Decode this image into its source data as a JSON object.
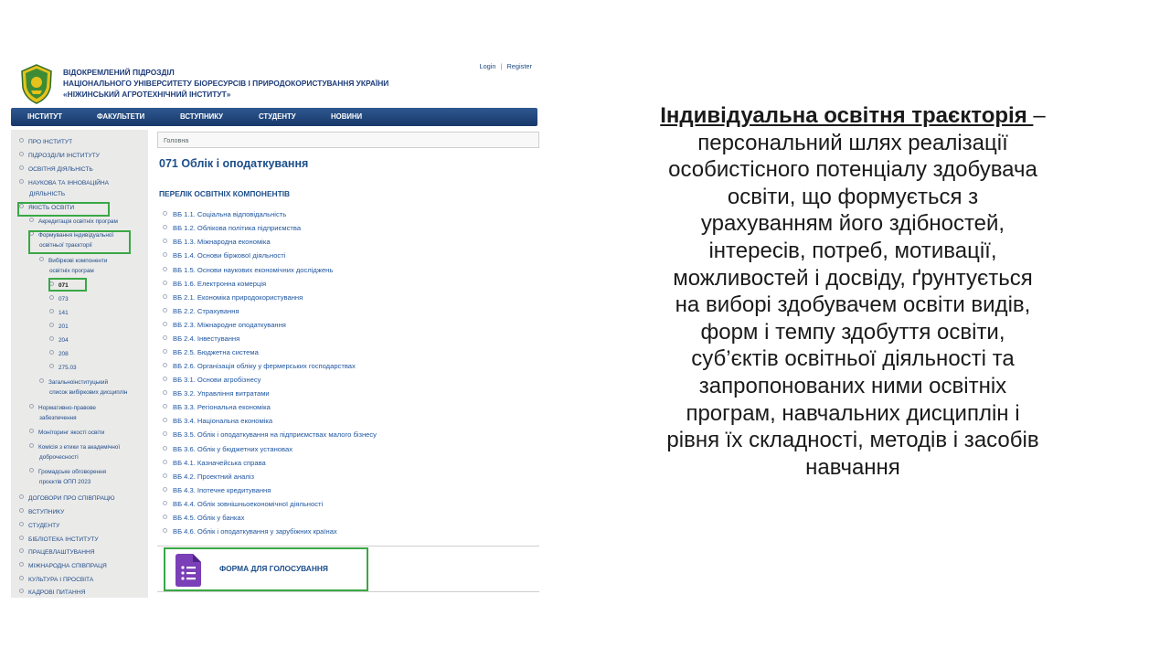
{
  "header": {
    "title_lines": [
      "ВІДОКРЕМЛЕНИЙ ПІДРОЗДІЛ",
      "НАЦІОНАЛЬНОГО УНІВЕРСИТЕТУ БІОРЕСУРСІВ І ПРИРОДОКОРИСТУВАННЯ УКРАЇНИ",
      "«НІЖИНСЬКИЙ АГРОТЕХНІЧНИЙ ІНСТИТУТ»"
    ],
    "login": "Login",
    "separator": "|",
    "register": "Register"
  },
  "topnav": [
    "ІНСТИТУТ",
    "ФАКУЛЬТЕТИ",
    "ВСТУПНИКУ",
    "СТУДЕНТУ",
    "НОВИНИ"
  ],
  "sidebar": {
    "items": [
      "ПРО ІНСТИТУТ",
      "ПІДРОЗДІЛИ ІНСТИТУТУ",
      "ОСВІТНЯ ДІЯЛЬНІСТЬ",
      "НАУКОВА ТА ІННОВАЦІЙНА",
      "ДІЯЛЬНІСТЬ",
      "ЯКІСТЬ ОСВІТИ",
      "Акредитація освітніх програм",
      "Формування індивідуальної",
      "освітньої траєкторії",
      "Вибіркові компоненти",
      "освітніх програм",
      "071",
      "073",
      "141",
      "201",
      "204",
      "208",
      "275.03",
      "Загальноінституцький",
      "список вибіркових дисциплін",
      "Нормативно-правове",
      "забезпечення",
      "Моніторинг якості освіти",
      "Комісія з етики та академічної",
      "доброчесності",
      "Громадське обговорення",
      "проєктів ОПП 2023",
      "ДОГОВОРИ ПРО СПІВПРАЦЮ",
      "ВСТУПНИКУ",
      "СТУДЕНТУ",
      "БІБЛІОТЕКА ІНСТИТУТУ",
      "ПРАЦЕВЛАШТУВАННЯ",
      "МІЖНАРОДНА СПІВПРАЦЯ",
      "КУЛЬТУРА І ПРОСВІТА",
      "КАДРОВІ ПИТАННЯ"
    ]
  },
  "main": {
    "breadcrumb": "Головна",
    "title": "071 Облік і оподаткування",
    "section_title": "ПЕРЕЛІК ОСВІТНІХ КОМПОНЕНТІВ",
    "components": [
      "ВБ 1.1. Соціальна відповідальність",
      "ВБ 1.2. Облікова політика підприємства",
      "ВБ 1.3. Міжнародна економіка",
      "ВБ 1.4. Основи біржової діяльності",
      "ВБ 1.5. Основи  наукових економічних досліджень",
      "ВБ 1.6. Електронна комерція",
      "ВБ 2.1. Економіка природокористування",
      "ВБ 2.2. Страхування",
      "ВБ 2.3. Міжнародне оподаткування",
      "ВБ 2.4. Інвестування",
      "ВБ 2.5. Бюджетна система",
      "ВБ 2.6. Організація обліку у фермерських господарствах",
      "ВБ 3.1. Основи агробізнесу",
      "ВБ 3.2. Управління витратами",
      "ВБ 3.3. Регіональна економіка",
      "ВБ 3.4. Національна економіка",
      "ВБ 3.5. Облік і оподаткування на підприємствах малого бізнесу",
      "ВБ 3.6. Облік у бюджетних установах",
      "ВБ 4.1. Казначейська справа",
      "ВБ 4.2. Проектний аналіз",
      "ВБ 4.3. Іпотечне кредитування",
      "ВБ 4.4. Облік зовнішньоекономічної діяльності",
      "ВБ 4.5. Облік у банках",
      "ВБ 4.6. Облік і оподаткування у зарубіжних країнах"
    ],
    "vote_label": "ФОРМА ДЛЯ ГОЛОСУВАННЯ"
  },
  "definition": {
    "term": "Індивідуальна освітня траєкторія ",
    "dash": "–",
    "lines": [
      "персональний шлях реалізації",
      "особистісного потенціалу здобувача",
      "освіти, що формується з",
      "урахуванням його здібностей,",
      "інтересів, потреб, мотивації,",
      "можливостей і досвіду, ґрунтується",
      "на виборі здобувачем освіти видів,",
      "форм і темпу здобуття освіти,",
      "суб’єктів освітньої діяльності та",
      "запропонованих ними освітніх",
      "програм, навчальних дисциплін і",
      "рівня їх складності, методів і засобів",
      "навчання"
    ]
  },
  "colors": {
    "nav_bar": "#1f4577",
    "link": "#1f56a0",
    "heading": "#1c4e8a",
    "highlight_box": "#39a845",
    "sidebar_bg": "#eaeae9",
    "forms_icon": "#7b3fb8"
  }
}
